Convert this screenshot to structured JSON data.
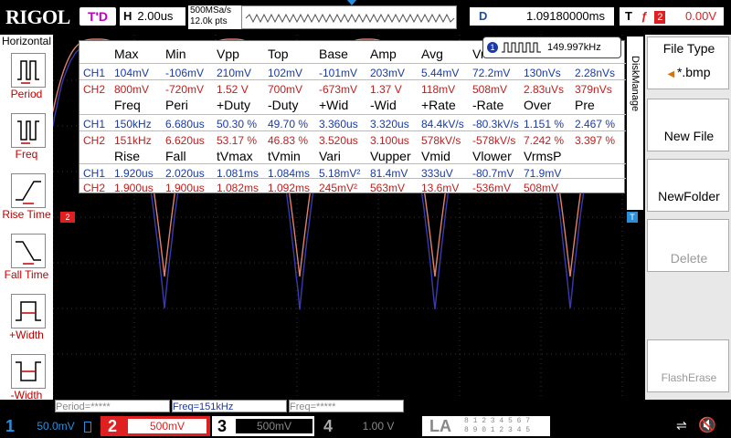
{
  "header": {
    "logo": "RIGOL",
    "trigger_status": "T'D",
    "h_label": "H",
    "timebase": "2.00us",
    "sample_rate": "500MSa/s",
    "memory_depth": "12.0k pts",
    "delay_label": "D",
    "delay_value": "1.09180000ms",
    "trigger_label": "T",
    "trigger_source": "2",
    "trigger_level": "0.00V"
  },
  "left_panel": {
    "title": "Horizontal",
    "items": [
      {
        "label": "Period",
        "icon": "period-icon"
      },
      {
        "label": "Freq",
        "icon": "freq-icon"
      },
      {
        "label": "Rise Time",
        "icon": "rise-time-icon"
      },
      {
        "label": "Fall Time",
        "icon": "fall-time-icon"
      },
      {
        "label": "+Width",
        "icon": "pos-width-icon"
      },
      {
        "label": "-Width",
        "icon": "neg-width-icon"
      }
    ]
  },
  "measurements": {
    "freq_badge": "149.997kHz",
    "freq_badge_ch": "1",
    "block1": {
      "headers": [
        "Max",
        "Min",
        "Vpp",
        "Top",
        "Base",
        "Amp",
        "Avg",
        "Vrms",
        "",
        ""
      ],
      "ch1": [
        "CH1",
        "104mV",
        "-106mV",
        "210mV",
        "102mV",
        "-101mV",
        "203mV",
        "5.44mV",
        "72.2mV",
        "130nVs",
        "2.28nVs"
      ],
      "ch2": [
        "CH2",
        "800mV",
        "-720mV",
        "1.52 V",
        "700mV",
        "-673mV",
        "1.37 V",
        "118mV",
        "508mV",
        "2.83uVs",
        "379nVs"
      ]
    },
    "block2": {
      "headers": [
        "Freq",
        "Peri",
        "+Duty",
        "-Duty",
        "+Wid",
        "-Wid",
        "+Rate",
        "-Rate",
        "Over",
        "Pre"
      ],
      "ch1": [
        "CH1",
        "150kHz",
        "6.680us",
        "50.30 %",
        "49.70 %",
        "3.360us",
        "3.320us",
        "84.4kV/s",
        "-80.3kV/s",
        "1.151 %",
        "2.467 %"
      ],
      "ch2": [
        "CH2",
        "151kHz",
        "6.620us",
        "53.17 %",
        "46.83 %",
        "3.520us",
        "3.100us",
        "578kV/s",
        "-578kV/s",
        "7.242 %",
        "3.397 %"
      ]
    },
    "block3": {
      "headers": [
        "Rise",
        "Fall",
        "tVmax",
        "tVmin",
        "Vari",
        "Vupper",
        "Vmid",
        "Vlower",
        "VrmsP"
      ],
      "ch1": [
        "CH1",
        "1.920us",
        "2.020us",
        "1.081ms",
        "1.084ms",
        "5.18mV²",
        "81.4mV",
        "333uV",
        "-80.7mV",
        "71.9mV"
      ],
      "ch2": [
        "CH2",
        "1.900us",
        "1.900us",
        "1.082ms",
        "1.092ms",
        "245mV²",
        "563mV",
        "13.6mV",
        "-536mV",
        "508mV"
      ]
    }
  },
  "right_panel": {
    "tab": "DiskManage",
    "file_type_title": "File Type",
    "file_type_value": "*.bmp",
    "new_file": "New File",
    "new_folder": "NewFolder",
    "delete": "Delete",
    "flash_erase": "FlashErase"
  },
  "info_bar": {
    "period": "Period=*****",
    "freq": "Freq=151kHz",
    "freq2": "Freq=*****"
  },
  "channels": {
    "ch1_num": "1",
    "ch1_scale": "50.0mV",
    "ch2_num": "2",
    "ch2_scale": "500mV",
    "ch3_num": "3",
    "ch3_scale": "500mV",
    "ch4_num": "4",
    "ch4_scale": "1.00 V",
    "la": "LA",
    "la_bits_top": "8 1 2 3   4 5 6 7",
    "la_bits_bottom": "8 9 0 1   2 3 4 5"
  },
  "markers": {
    "ch2": "2",
    "trigger": "T"
  },
  "colors": {
    "ch1": "#3a3ab0",
    "ch2": "#e08070",
    "accent_red": "#e02020"
  }
}
